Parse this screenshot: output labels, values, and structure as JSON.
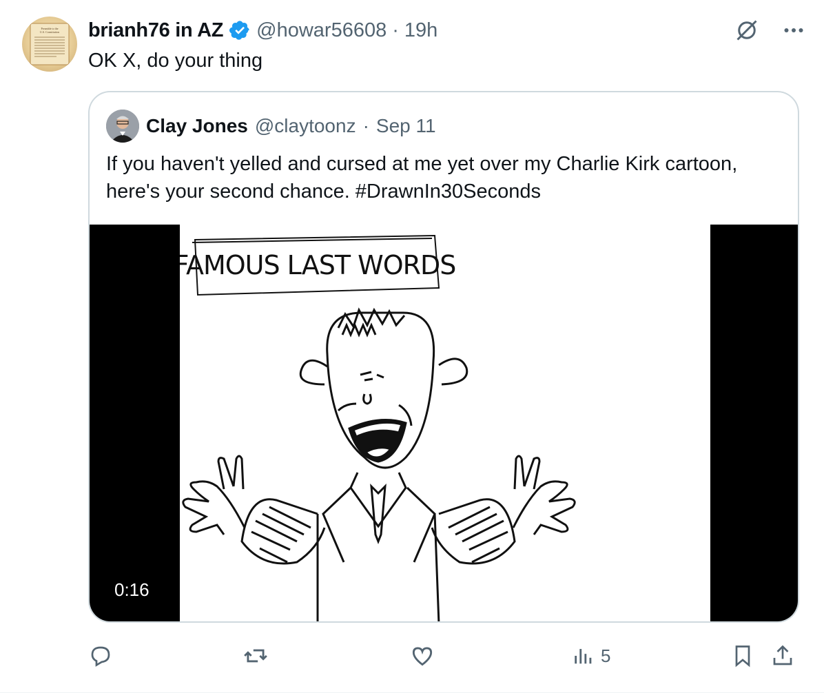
{
  "post": {
    "author_name": "brianh76 in AZ",
    "handle": "@howar56608",
    "separator": "·",
    "time": "19h",
    "text": "OK X, do your thing",
    "avatar_icon": "constitution-scroll-avatar",
    "avatar_text": [
      "Preamble to the",
      "U.S. Constitution",
      "We the People of the United States, in Order to form a more perfect Union, establish Justice, insure domestic Tranquility, provide for the common defence, promote the general Welfare, and secure the Blessings of Liberty to ourselves and our Posterity, do ordain and establish this Constitution for the United States of America."
    ],
    "verified_color": "#1d9bf0"
  },
  "quote": {
    "author_name": "Clay Jones",
    "handle": "@claytoonz",
    "separator": "·",
    "time": "Sep 11",
    "text": "If you haven't yelled and cursed at me yet over my Charlie Kirk cartoon, here's your second chance. #DrawnIn30Seconds",
    "media": {
      "caption_box_text": "FAMOUS LAST WORDS",
      "duration": "0:16"
    }
  },
  "actions": {
    "views": "5",
    "icons": [
      "reply-icon",
      "repost-icon",
      "like-icon",
      "views-icon",
      "bookmark-icon",
      "share-icon"
    ]
  },
  "top_icons": [
    "grok-slash-icon",
    "more-icon"
  ],
  "colors": {
    "text": "#0f1419",
    "secondary": "#536471",
    "border": "#cfd9de"
  }
}
